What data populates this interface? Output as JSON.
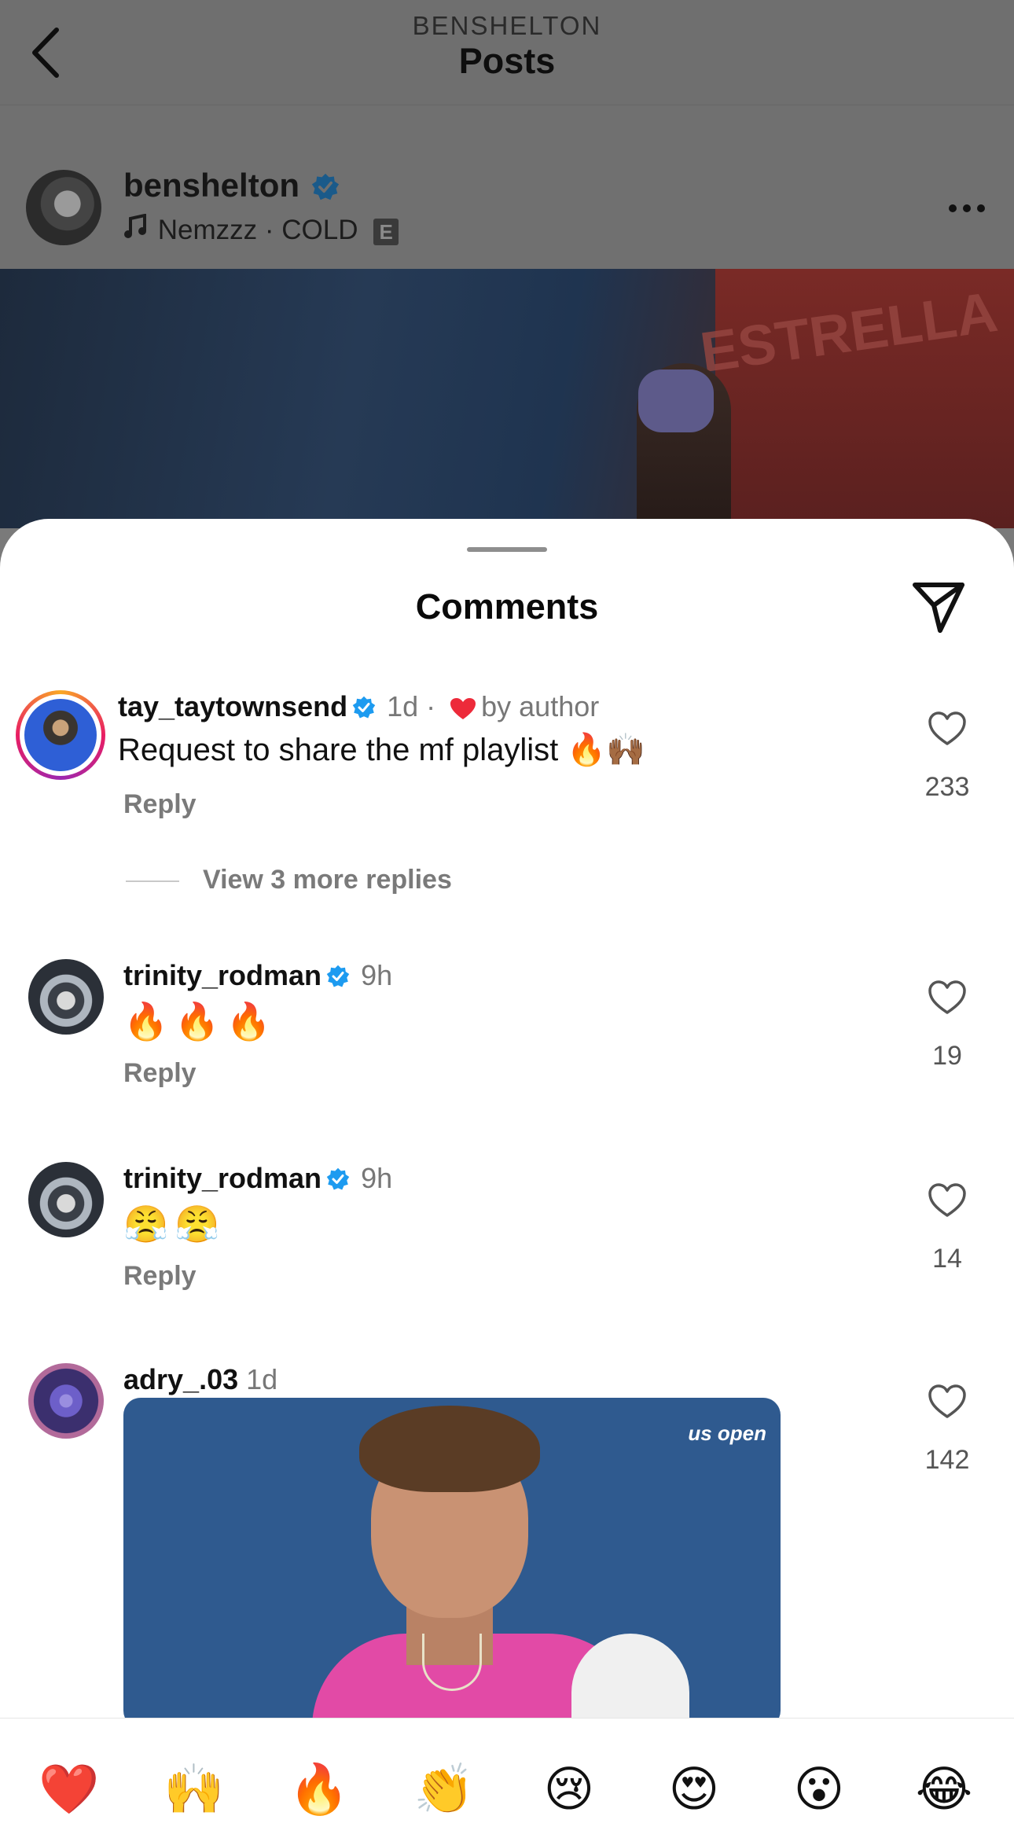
{
  "header": {
    "account": "BENSHELTON",
    "title": "Posts"
  },
  "post": {
    "username": "benshelton",
    "verified": true,
    "music": "Nemzzz · COLD",
    "explicit_badge": "E",
    "image_banner_text": "ESTRELLA"
  },
  "comments_sheet": {
    "title": "Comments",
    "comments": [
      {
        "username": "tay_taytownsend",
        "verified": true,
        "time": "1d",
        "liked_by_author": "by author",
        "text": "Request to share the mf playlist",
        "emojis": "🔥🙌🏾",
        "reply_label": "Reply",
        "likes": "233",
        "view_replies": "View 3 more replies"
      },
      {
        "username": "trinity_rodman",
        "verified": true,
        "time": "9h",
        "text": "🔥🔥🔥",
        "reply_label": "Reply",
        "likes": "19"
      },
      {
        "username": "trinity_rodman",
        "verified": true,
        "time": "9h",
        "text": "😤😤",
        "reply_label": "Reply",
        "likes": "14"
      },
      {
        "username": "adry_.03",
        "verified": false,
        "time": "1d",
        "gif_logo": "us open",
        "likes": "142"
      }
    ]
  },
  "reactions": [
    "❤️",
    "🙌",
    "🔥",
    "👏",
    "😢",
    "😍",
    "😮",
    "😂"
  ],
  "colors": {
    "verified_blue": "#1d9bf0",
    "like_red": "#ed2a3a",
    "text_secondary": "#777777"
  }
}
